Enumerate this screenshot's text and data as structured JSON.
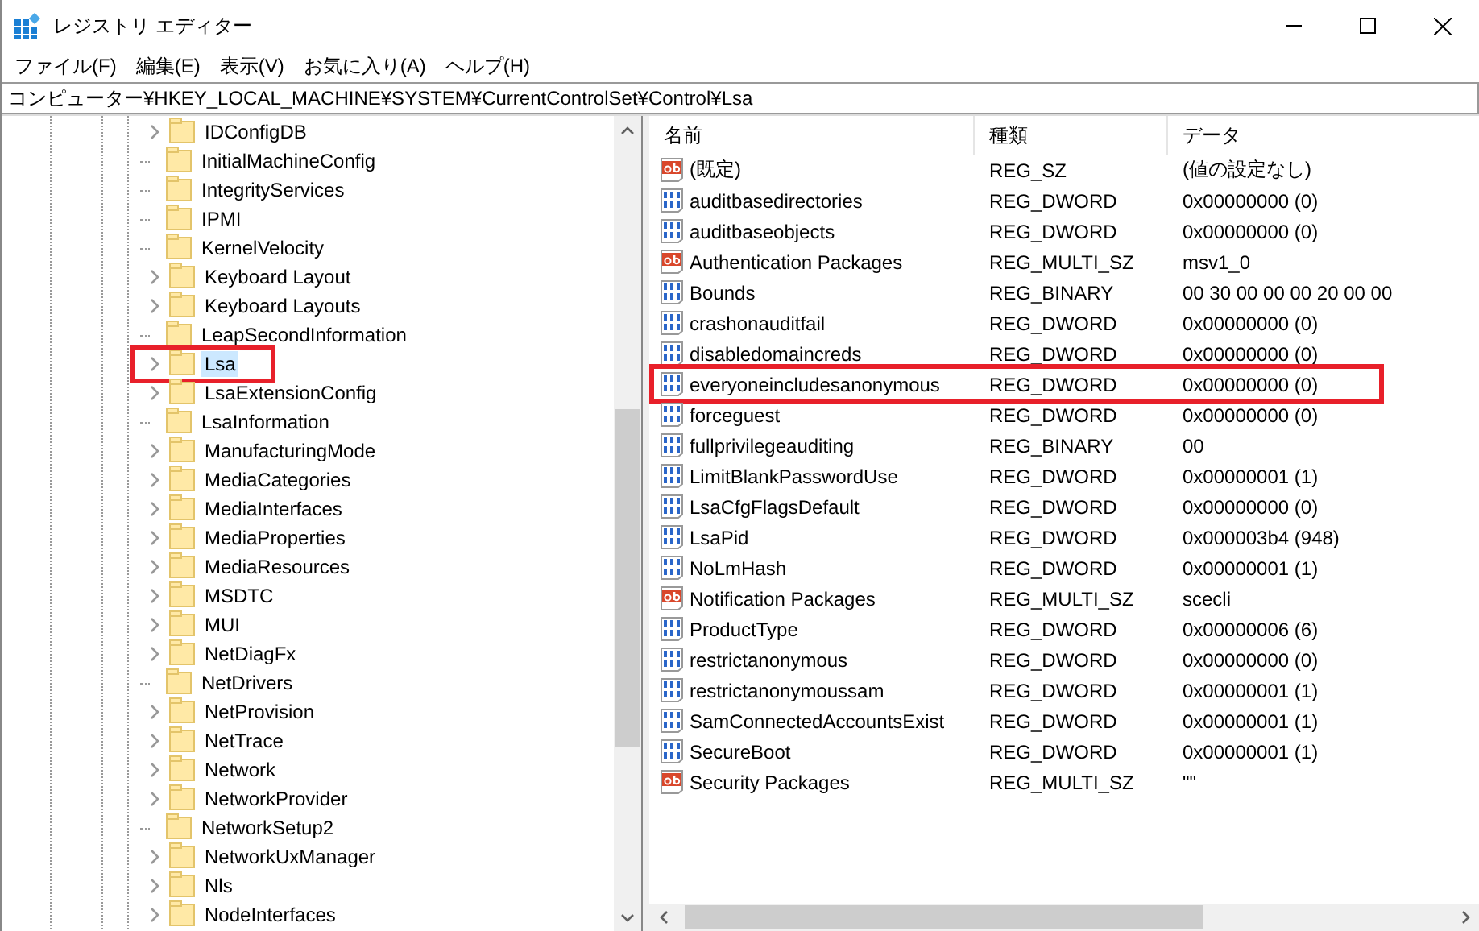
{
  "window": {
    "title": "レジストリ エディター"
  },
  "menu": [
    "ファイル(F)",
    "編集(E)",
    "表示(V)",
    "お気に入り(A)",
    "ヘルプ(H)"
  ],
  "address": "コンピューター¥HKEY_LOCAL_MACHINE¥SYSTEM¥CurrentControlSet¥Control¥Lsa",
  "tree": [
    {
      "label": "IDConfigDB",
      "expandable": true,
      "selected": false,
      "highlighted": false
    },
    {
      "label": "InitialMachineConfig",
      "expandable": false,
      "selected": false,
      "highlighted": false
    },
    {
      "label": "IntegrityServices",
      "expandable": false,
      "selected": false,
      "highlighted": false
    },
    {
      "label": "IPMI",
      "expandable": false,
      "selected": false,
      "highlighted": false
    },
    {
      "label": "KernelVelocity",
      "expandable": false,
      "selected": false,
      "highlighted": false
    },
    {
      "label": "Keyboard Layout",
      "expandable": true,
      "selected": false,
      "highlighted": false
    },
    {
      "label": "Keyboard Layouts",
      "expandable": true,
      "selected": false,
      "highlighted": false
    },
    {
      "label": "LeapSecondInformation",
      "expandable": false,
      "selected": false,
      "highlighted": false
    },
    {
      "label": "Lsa",
      "expandable": true,
      "selected": true,
      "highlighted": true
    },
    {
      "label": "LsaExtensionConfig",
      "expandable": true,
      "selected": false,
      "highlighted": false
    },
    {
      "label": "LsaInformation",
      "expandable": false,
      "selected": false,
      "highlighted": false
    },
    {
      "label": "ManufacturingMode",
      "expandable": true,
      "selected": false,
      "highlighted": false
    },
    {
      "label": "MediaCategories",
      "expandable": true,
      "selected": false,
      "highlighted": false
    },
    {
      "label": "MediaInterfaces",
      "expandable": true,
      "selected": false,
      "highlighted": false
    },
    {
      "label": "MediaProperties",
      "expandable": true,
      "selected": false,
      "highlighted": false
    },
    {
      "label": "MediaResources",
      "expandable": true,
      "selected": false,
      "highlighted": false
    },
    {
      "label": "MSDTC",
      "expandable": true,
      "selected": false,
      "highlighted": false
    },
    {
      "label": "MUI",
      "expandable": true,
      "selected": false,
      "highlighted": false
    },
    {
      "label": "NetDiagFx",
      "expandable": true,
      "selected": false,
      "highlighted": false
    },
    {
      "label": "NetDrivers",
      "expandable": false,
      "selected": false,
      "highlighted": false
    },
    {
      "label": "NetProvision",
      "expandable": true,
      "selected": false,
      "highlighted": false
    },
    {
      "label": "NetTrace",
      "expandable": true,
      "selected": false,
      "highlighted": false
    },
    {
      "label": "Network",
      "expandable": true,
      "selected": false,
      "highlighted": false
    },
    {
      "label": "NetworkProvider",
      "expandable": true,
      "selected": false,
      "highlighted": false
    },
    {
      "label": "NetworkSetup2",
      "expandable": false,
      "selected": false,
      "highlighted": false
    },
    {
      "label": "NetworkUxManager",
      "expandable": true,
      "selected": false,
      "highlighted": false
    },
    {
      "label": "Nls",
      "expandable": true,
      "selected": false,
      "highlighted": false
    },
    {
      "label": "NodeInterfaces",
      "expandable": true,
      "selected": false,
      "highlighted": false
    }
  ],
  "values": {
    "columns": [
      "名前",
      "種類",
      "データ"
    ],
    "rows": [
      {
        "kind": "string",
        "name": "(既定)",
        "type": "REG_SZ",
        "data": "(値の設定なし)",
        "highlighted": false
      },
      {
        "kind": "binary",
        "name": "auditbasedirectories",
        "type": "REG_DWORD",
        "data": "0x00000000 (0)",
        "highlighted": false
      },
      {
        "kind": "binary",
        "name": "auditbaseobjects",
        "type": "REG_DWORD",
        "data": "0x00000000 (0)",
        "highlighted": false
      },
      {
        "kind": "string",
        "name": "Authentication Packages",
        "type": "REG_MULTI_SZ",
        "data": "msv1_0",
        "highlighted": false
      },
      {
        "kind": "binary",
        "name": "Bounds",
        "type": "REG_BINARY",
        "data": "00 30 00 00 00 20 00 00",
        "highlighted": false
      },
      {
        "kind": "binary",
        "name": "crashonauditfail",
        "type": "REG_DWORD",
        "data": "0x00000000 (0)",
        "highlighted": false
      },
      {
        "kind": "binary",
        "name": "disabledomaincreds",
        "type": "REG_DWORD",
        "data": "0x00000000 (0)",
        "highlighted": false
      },
      {
        "kind": "binary",
        "name": "everyoneincludesanonymous",
        "type": "REG_DWORD",
        "data": "0x00000000 (0)",
        "highlighted": true
      },
      {
        "kind": "binary",
        "name": "forceguest",
        "type": "REG_DWORD",
        "data": "0x00000000 (0)",
        "highlighted": false
      },
      {
        "kind": "binary",
        "name": "fullprivilegeauditing",
        "type": "REG_BINARY",
        "data": "00",
        "highlighted": false
      },
      {
        "kind": "binary",
        "name": "LimitBlankPasswordUse",
        "type": "REG_DWORD",
        "data": "0x00000001 (1)",
        "highlighted": false
      },
      {
        "kind": "binary",
        "name": "LsaCfgFlagsDefault",
        "type": "REG_DWORD",
        "data": "0x00000000 (0)",
        "highlighted": false
      },
      {
        "kind": "binary",
        "name": "LsaPid",
        "type": "REG_DWORD",
        "data": "0x000003b4 (948)",
        "highlighted": false
      },
      {
        "kind": "binary",
        "name": "NoLmHash",
        "type": "REG_DWORD",
        "data": "0x00000001 (1)",
        "highlighted": false
      },
      {
        "kind": "string",
        "name": "Notification Packages",
        "type": "REG_MULTI_SZ",
        "data": "scecli",
        "highlighted": false
      },
      {
        "kind": "binary",
        "name": "ProductType",
        "type": "REG_DWORD",
        "data": "0x00000006 (6)",
        "highlighted": false
      },
      {
        "kind": "binary",
        "name": "restrictanonymous",
        "type": "REG_DWORD",
        "data": "0x00000000 (0)",
        "highlighted": false
      },
      {
        "kind": "binary",
        "name": "restrictanonymoussam",
        "type": "REG_DWORD",
        "data": "0x00000001 (1)",
        "highlighted": false
      },
      {
        "kind": "binary",
        "name": "SamConnectedAccountsExist",
        "type": "REG_DWORD",
        "data": "0x00000001 (1)",
        "highlighted": false
      },
      {
        "kind": "binary",
        "name": "SecureBoot",
        "type": "REG_DWORD",
        "data": "0x00000001 (1)",
        "highlighted": false
      },
      {
        "kind": "string",
        "name": "Security Packages",
        "type": "REG_MULTI_SZ",
        "data": "\"\"",
        "highlighted": false
      }
    ]
  }
}
